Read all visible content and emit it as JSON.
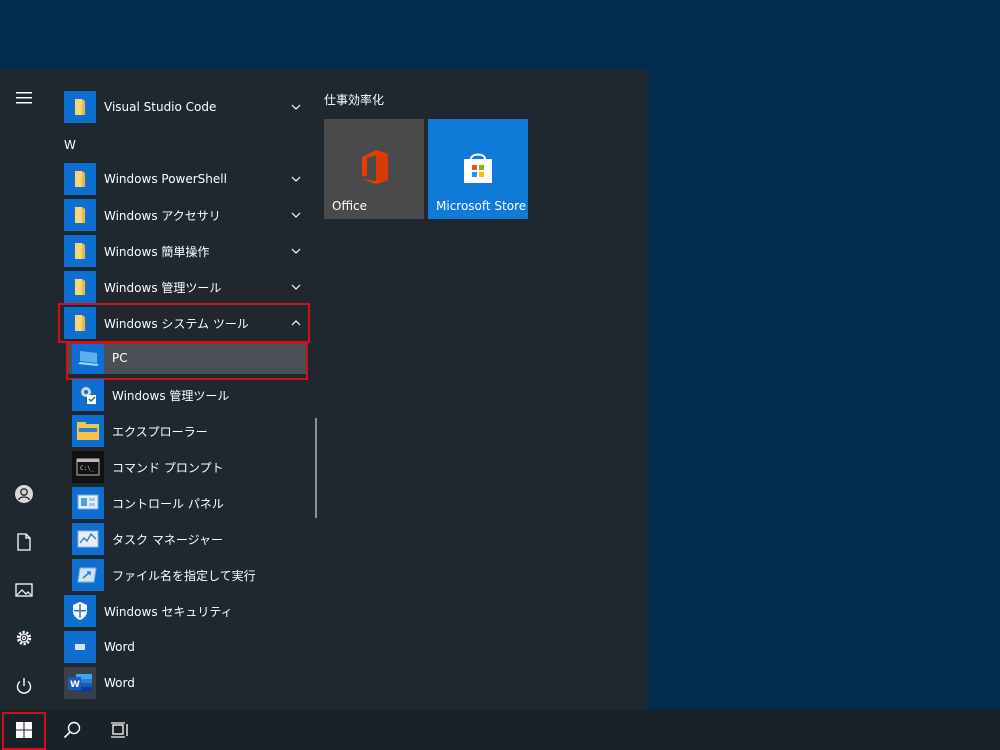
{
  "applist": {
    "top_item": "Visual Studio Code",
    "letter_w": "W",
    "items": [
      "Windows PowerShell",
      "Windows アクセサリ",
      "Windows 簡単操作",
      "Windows 管理ツール",
      "Windows システム ツール"
    ],
    "system_tools": [
      "PC",
      "Windows 管理ツール",
      "エクスプローラー",
      "コマンド プロンプト",
      "コントロール パネル",
      "タスク マネージャー",
      "ファイル名を指定して実行"
    ],
    "after": [
      "Windows セキュリティ",
      "Word",
      "Word"
    ]
  },
  "tiles": {
    "group_title": "仕事効率化",
    "office_label": "Office",
    "store_label": "Microsoft Store"
  },
  "colors": {
    "accent": "#0f6fd1",
    "highlight_box": "#d0101a",
    "menu_bg": "#1f272f",
    "desktop_bg": "#032b4d"
  }
}
